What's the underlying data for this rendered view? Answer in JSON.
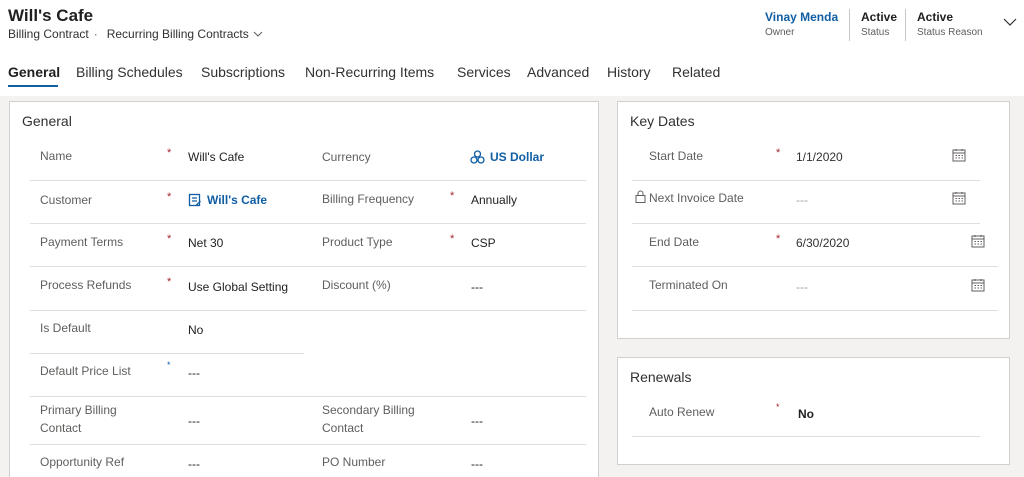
{
  "header": {
    "title": "Will's Cafe",
    "entity": "Billing Contract",
    "separator": "·",
    "view": "Recurring Billing Contracts",
    "owner_value": "Vinay Menda",
    "owner_label": "Owner",
    "status_value": "Active",
    "status_label": "Status",
    "status_reason_value": "Active",
    "status_reason_label": "Status Reason"
  },
  "tabs": [
    {
      "label": "General"
    },
    {
      "label": "Billing Schedules"
    },
    {
      "label": "Subscriptions"
    },
    {
      "label": "Non-Recurring Items"
    },
    {
      "label": "Services"
    },
    {
      "label": "Advanced"
    },
    {
      "label": "History"
    },
    {
      "label": "Related"
    }
  ],
  "general": {
    "title": "General",
    "name_label": "Name",
    "name_value": "Will's Cafe",
    "currency_label": "Currency",
    "currency_value": "US Dollar",
    "customer_label": "Customer",
    "customer_value": "Will's Cafe",
    "billing_frequency_label": "Billing Frequency",
    "billing_frequency_value": "Annually",
    "payment_terms_label": "Payment Terms",
    "payment_terms_value": "Net 30",
    "product_type_label": "Product Type",
    "product_type_value": "CSP",
    "process_refunds_label": "Process Refunds",
    "process_refunds_value": "Use Global Setting",
    "discount_label": "Discount (%)",
    "discount_value": "---",
    "is_default_label": "Is Default",
    "is_default_value": "No",
    "default_price_list_label": "Default Price List",
    "default_price_list_value": "---",
    "primary_billing_label_1": "Primary Billing",
    "primary_billing_label_2": "Contact",
    "primary_billing_value": "---",
    "secondary_billing_label_1": "Secondary Billing",
    "secondary_billing_label_2": "Contact",
    "secondary_billing_value": "---",
    "opportunity_ref_label": "Opportunity Ref",
    "opportunity_ref_value": "---",
    "po_number_label": "PO Number",
    "po_number_value": "---",
    "required_mark": "*",
    "recommended_mark": "*"
  },
  "key_dates": {
    "title": "Key Dates",
    "start_date_label": "Start Date",
    "start_date_value": "1/1/2020",
    "next_invoice_label": "Next Invoice Date",
    "next_invoice_value": "---",
    "end_date_label": "End Date",
    "end_date_value": "6/30/2020",
    "terminated_on_label": "Terminated On",
    "terminated_on_value": "---"
  },
  "renewals": {
    "title": "Renewals",
    "auto_renew_label": "Auto Renew",
    "auto_renew_value": "No"
  },
  "colors": {
    "accent": "#115ea3",
    "required": "#a4262c",
    "border": "#d2d0ce",
    "background": "#f3f2f1"
  }
}
